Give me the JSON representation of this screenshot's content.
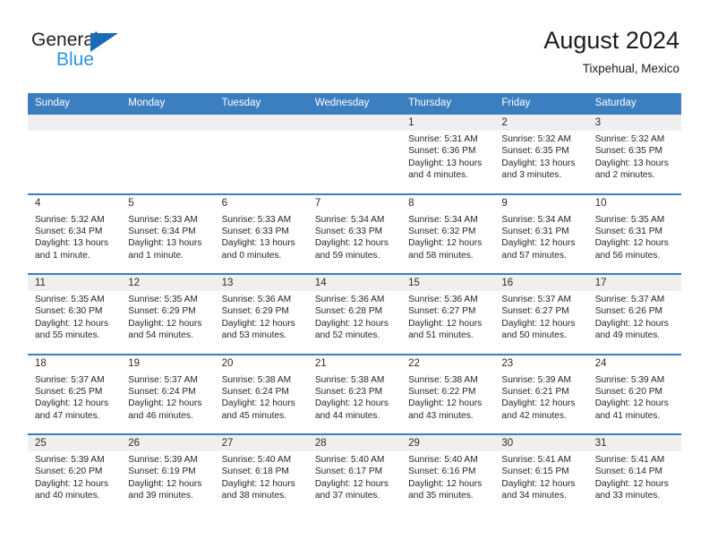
{
  "brand": {
    "name_part1": "General",
    "name_part2": "Blue",
    "triangle_color": "#1a6cb5",
    "blue_color": "#2b95e0"
  },
  "header": {
    "title": "August 2024",
    "subtitle": "Tixpehual, Mexico"
  },
  "theme": {
    "header_blue": "#3c7fc1",
    "band_gray": "#efefef",
    "text_dark": "#262626"
  },
  "weekdays": [
    "Sunday",
    "Monday",
    "Tuesday",
    "Wednesday",
    "Thursday",
    "Friday",
    "Saturday"
  ],
  "weeks": [
    {
      "shaded": true,
      "days": [
        {
          "num": "",
          "sunrise": "",
          "sunset": "",
          "daylight1": "",
          "daylight2": "",
          "empty": true
        },
        {
          "num": "",
          "sunrise": "",
          "sunset": "",
          "daylight1": "",
          "daylight2": "",
          "empty": true
        },
        {
          "num": "",
          "sunrise": "",
          "sunset": "",
          "daylight1": "",
          "daylight2": "",
          "empty": true
        },
        {
          "num": "",
          "sunrise": "",
          "sunset": "",
          "daylight1": "",
          "daylight2": "",
          "empty": true
        },
        {
          "num": "1",
          "sunrise": "Sunrise: 5:31 AM",
          "sunset": "Sunset: 6:36 PM",
          "daylight1": "Daylight: 13 hours",
          "daylight2": "and 4 minutes.",
          "empty": false
        },
        {
          "num": "2",
          "sunrise": "Sunrise: 5:32 AM",
          "sunset": "Sunset: 6:35 PM",
          "daylight1": "Daylight: 13 hours",
          "daylight2": "and 3 minutes.",
          "empty": false
        },
        {
          "num": "3",
          "sunrise": "Sunrise: 5:32 AM",
          "sunset": "Sunset: 6:35 PM",
          "daylight1": "Daylight: 13 hours",
          "daylight2": "and 2 minutes.",
          "empty": false
        }
      ]
    },
    {
      "shaded": false,
      "days": [
        {
          "num": "4",
          "sunrise": "Sunrise: 5:32 AM",
          "sunset": "Sunset: 6:34 PM",
          "daylight1": "Daylight: 13 hours",
          "daylight2": "and 1 minute.",
          "empty": false
        },
        {
          "num": "5",
          "sunrise": "Sunrise: 5:33 AM",
          "sunset": "Sunset: 6:34 PM",
          "daylight1": "Daylight: 13 hours",
          "daylight2": "and 1 minute.",
          "empty": false
        },
        {
          "num": "6",
          "sunrise": "Sunrise: 5:33 AM",
          "sunset": "Sunset: 6:33 PM",
          "daylight1": "Daylight: 13 hours",
          "daylight2": "and 0 minutes.",
          "empty": false
        },
        {
          "num": "7",
          "sunrise": "Sunrise: 5:34 AM",
          "sunset": "Sunset: 6:33 PM",
          "daylight1": "Daylight: 12 hours",
          "daylight2": "and 59 minutes.",
          "empty": false
        },
        {
          "num": "8",
          "sunrise": "Sunrise: 5:34 AM",
          "sunset": "Sunset: 6:32 PM",
          "daylight1": "Daylight: 12 hours",
          "daylight2": "and 58 minutes.",
          "empty": false
        },
        {
          "num": "9",
          "sunrise": "Sunrise: 5:34 AM",
          "sunset": "Sunset: 6:31 PM",
          "daylight1": "Daylight: 12 hours",
          "daylight2": "and 57 minutes.",
          "empty": false
        },
        {
          "num": "10",
          "sunrise": "Sunrise: 5:35 AM",
          "sunset": "Sunset: 6:31 PM",
          "daylight1": "Daylight: 12 hours",
          "daylight2": "and 56 minutes.",
          "empty": false
        }
      ]
    },
    {
      "shaded": true,
      "days": [
        {
          "num": "11",
          "sunrise": "Sunrise: 5:35 AM",
          "sunset": "Sunset: 6:30 PM",
          "daylight1": "Daylight: 12 hours",
          "daylight2": "and 55 minutes.",
          "empty": false
        },
        {
          "num": "12",
          "sunrise": "Sunrise: 5:35 AM",
          "sunset": "Sunset: 6:29 PM",
          "daylight1": "Daylight: 12 hours",
          "daylight2": "and 54 minutes.",
          "empty": false
        },
        {
          "num": "13",
          "sunrise": "Sunrise: 5:36 AM",
          "sunset": "Sunset: 6:29 PM",
          "daylight1": "Daylight: 12 hours",
          "daylight2": "and 53 minutes.",
          "empty": false
        },
        {
          "num": "14",
          "sunrise": "Sunrise: 5:36 AM",
          "sunset": "Sunset: 6:28 PM",
          "daylight1": "Daylight: 12 hours",
          "daylight2": "and 52 minutes.",
          "empty": false
        },
        {
          "num": "15",
          "sunrise": "Sunrise: 5:36 AM",
          "sunset": "Sunset: 6:27 PM",
          "daylight1": "Daylight: 12 hours",
          "daylight2": "and 51 minutes.",
          "empty": false
        },
        {
          "num": "16",
          "sunrise": "Sunrise: 5:37 AM",
          "sunset": "Sunset: 6:27 PM",
          "daylight1": "Daylight: 12 hours",
          "daylight2": "and 50 minutes.",
          "empty": false
        },
        {
          "num": "17",
          "sunrise": "Sunrise: 5:37 AM",
          "sunset": "Sunset: 6:26 PM",
          "daylight1": "Daylight: 12 hours",
          "daylight2": "and 49 minutes.",
          "empty": false
        }
      ]
    },
    {
      "shaded": false,
      "days": [
        {
          "num": "18",
          "sunrise": "Sunrise: 5:37 AM",
          "sunset": "Sunset: 6:25 PM",
          "daylight1": "Daylight: 12 hours",
          "daylight2": "and 47 minutes.",
          "empty": false
        },
        {
          "num": "19",
          "sunrise": "Sunrise: 5:37 AM",
          "sunset": "Sunset: 6:24 PM",
          "daylight1": "Daylight: 12 hours",
          "daylight2": "and 46 minutes.",
          "empty": false
        },
        {
          "num": "20",
          "sunrise": "Sunrise: 5:38 AM",
          "sunset": "Sunset: 6:24 PM",
          "daylight1": "Daylight: 12 hours",
          "daylight2": "and 45 minutes.",
          "empty": false
        },
        {
          "num": "21",
          "sunrise": "Sunrise: 5:38 AM",
          "sunset": "Sunset: 6:23 PM",
          "daylight1": "Daylight: 12 hours",
          "daylight2": "and 44 minutes.",
          "empty": false
        },
        {
          "num": "22",
          "sunrise": "Sunrise: 5:38 AM",
          "sunset": "Sunset: 6:22 PM",
          "daylight1": "Daylight: 12 hours",
          "daylight2": "and 43 minutes.",
          "empty": false
        },
        {
          "num": "23",
          "sunrise": "Sunrise: 5:39 AM",
          "sunset": "Sunset: 6:21 PM",
          "daylight1": "Daylight: 12 hours",
          "daylight2": "and 42 minutes.",
          "empty": false
        },
        {
          "num": "24",
          "sunrise": "Sunrise: 5:39 AM",
          "sunset": "Sunset: 6:20 PM",
          "daylight1": "Daylight: 12 hours",
          "daylight2": "and 41 minutes.",
          "empty": false
        }
      ]
    },
    {
      "shaded": true,
      "days": [
        {
          "num": "25",
          "sunrise": "Sunrise: 5:39 AM",
          "sunset": "Sunset: 6:20 PM",
          "daylight1": "Daylight: 12 hours",
          "daylight2": "and 40 minutes.",
          "empty": false
        },
        {
          "num": "26",
          "sunrise": "Sunrise: 5:39 AM",
          "sunset": "Sunset: 6:19 PM",
          "daylight1": "Daylight: 12 hours",
          "daylight2": "and 39 minutes.",
          "empty": false
        },
        {
          "num": "27",
          "sunrise": "Sunrise: 5:40 AM",
          "sunset": "Sunset: 6:18 PM",
          "daylight1": "Daylight: 12 hours",
          "daylight2": "and 38 minutes.",
          "empty": false
        },
        {
          "num": "28",
          "sunrise": "Sunrise: 5:40 AM",
          "sunset": "Sunset: 6:17 PM",
          "daylight1": "Daylight: 12 hours",
          "daylight2": "and 37 minutes.",
          "empty": false
        },
        {
          "num": "29",
          "sunrise": "Sunrise: 5:40 AM",
          "sunset": "Sunset: 6:16 PM",
          "daylight1": "Daylight: 12 hours",
          "daylight2": "and 35 minutes.",
          "empty": false
        },
        {
          "num": "30",
          "sunrise": "Sunrise: 5:41 AM",
          "sunset": "Sunset: 6:15 PM",
          "daylight1": "Daylight: 12 hours",
          "daylight2": "and 34 minutes.",
          "empty": false
        },
        {
          "num": "31",
          "sunrise": "Sunrise: 5:41 AM",
          "sunset": "Sunset: 6:14 PM",
          "daylight1": "Daylight: 12 hours",
          "daylight2": "and 33 minutes.",
          "empty": false
        }
      ]
    }
  ]
}
